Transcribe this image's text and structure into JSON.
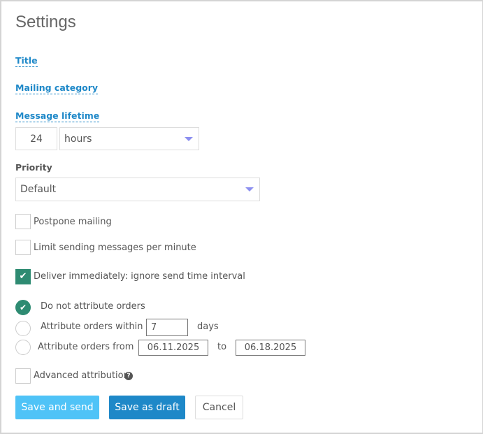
{
  "title": "Settings",
  "links": {
    "title": "Title",
    "mailing_category": "Mailing category",
    "message_lifetime": "Message lifetime"
  },
  "lifetime": {
    "value": "24",
    "unit": "hours"
  },
  "priority": {
    "label": "Priority",
    "value": "Default"
  },
  "checkboxes": {
    "postpone": {
      "label": "Postpone mailing",
      "checked": false
    },
    "limit": {
      "label": "Limit sending messages per minute",
      "checked": false
    },
    "deliver": {
      "label": "Deliver immediately: ignore send time interval",
      "checked": true
    },
    "advanced": {
      "label": "Advanced attribution",
      "checked": false
    }
  },
  "attribution": {
    "none": "Do not attribute orders",
    "within": "Attribute orders within",
    "within_value": "7",
    "days": "days",
    "from": "Attribute orders from",
    "from_date": "06.11.2025",
    "to": "to",
    "to_date": "06.18.2025",
    "selected": "none"
  },
  "buttons": {
    "save_send": "Save and send",
    "save_draft": "Save as draft",
    "cancel": "Cancel"
  },
  "colors": {
    "link": "#1e88c8",
    "check": "#2e8b72",
    "save_send": "#4fc3f7",
    "save_draft": "#1e88c8"
  }
}
